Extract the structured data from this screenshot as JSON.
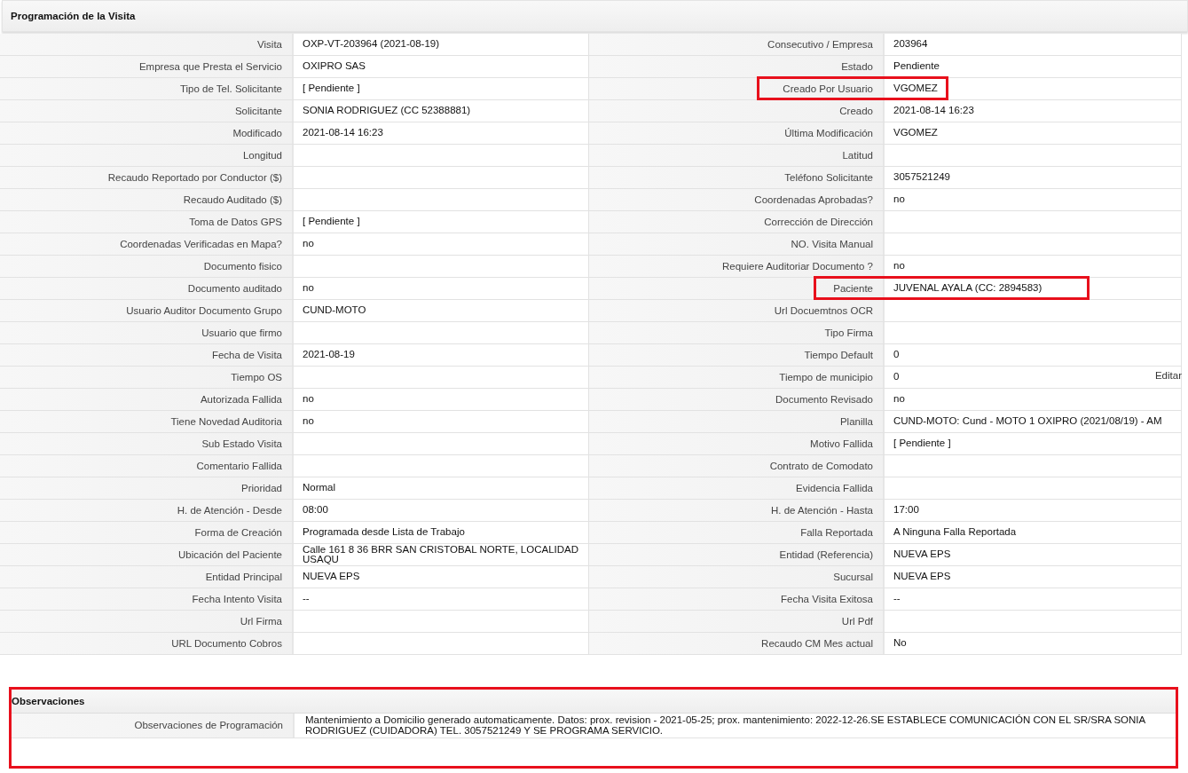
{
  "section_title": "Programación de la Visita",
  "rows": [
    {
      "left": {
        "label": "Visita",
        "value": "OXP-VT-203964 (2021-08-19)"
      },
      "right": {
        "label": "Consecutivo / Empresa",
        "value": "203964",
        "highlighted": false
      }
    },
    {
      "left": {
        "label": "Empresa que Presta el Servicio",
        "value": "OXIPRO SAS"
      },
      "right": {
        "label": "Estado",
        "value": "Pendiente",
        "highlighted": false
      }
    },
    {
      "left": {
        "label": "Tipo de Tel. Solicitante",
        "value": "[ Pendiente ]"
      },
      "right": {
        "label": "Creado Por Usuario",
        "value": "VGOMEZ",
        "highlighted": true
      }
    },
    {
      "left": {
        "label": "Solicitante",
        "value": "SONIA RODRIGUEZ (CC 52388881)"
      },
      "right": {
        "label": "Creado",
        "value": "2021-08-14 16:23",
        "highlighted": false
      }
    },
    {
      "left": {
        "label": "Modificado",
        "value": "2021-08-14 16:23"
      },
      "right": {
        "label": "Última Modificación",
        "value": "VGOMEZ",
        "highlighted": false
      }
    },
    {
      "left": {
        "label": "Longitud"
      },
      "right": {
        "label": "Latitud",
        "highlighted": false
      }
    },
    {
      "left": {
        "label": "Recaudo Reportado por Conductor ($)"
      },
      "right": {
        "label": "Teléfono Solicitante",
        "value": "3057521249",
        "highlighted": false
      }
    },
    {
      "left": {
        "label": "Recaudo Auditado ($)"
      },
      "right": {
        "label": "Coordenadas Aprobadas?",
        "value": "no",
        "highlighted": false
      }
    },
    {
      "left": {
        "label": "Toma de Datos GPS",
        "value": "[ Pendiente ]"
      },
      "right": {
        "label": "Corrección de Dirección",
        "highlighted": false
      }
    },
    {
      "left": {
        "label": "Coordenadas Verificadas en Mapa?",
        "value": "no"
      },
      "right": {
        "label": "NO. Visita Manual",
        "highlighted": false
      }
    },
    {
      "left": {
        "label": "Documento fisico"
      },
      "right": {
        "label": "Requiere Auditoriar Documento ?",
        "value": "no",
        "highlighted": false
      }
    },
    {
      "left": {
        "label": "Documento auditado",
        "value": "no"
      },
      "right": {
        "label": "Paciente",
        "value": "JUVENAL AYALA (CC: 2894583)",
        "highlighted": true
      }
    },
    {
      "left": {
        "label": "Usuario Auditor Documento Grupo",
        "value": "CUND-MOTO"
      },
      "right": {
        "label": "Url Docuemtnos OCR",
        "highlighted": false
      }
    },
    {
      "left": {
        "label": "Usuario que firmo"
      },
      "right": {
        "label": "Tipo Firma",
        "highlighted": false
      }
    },
    {
      "left": {
        "label": "Fecha de Visita",
        "value": "2021-08-19"
      },
      "right": {
        "label": "Tiempo Default",
        "value": "0",
        "highlighted": false
      }
    },
    {
      "left": {
        "label": "Tiempo OS"
      },
      "right": {
        "label": "Tiempo de municipio",
        "value": "0",
        "highlighted": false,
        "link": "Editar"
      }
    },
    {
      "left": {
        "label": "Autorizada Fallida",
        "value": "no"
      },
      "right": {
        "label": "Documento Revisado",
        "value": "no",
        "highlighted": false
      }
    },
    {
      "left": {
        "label": "Tiene Novedad Auditoria",
        "value": "no"
      },
      "right": {
        "label": "Planilla",
        "value": "CUND-MOTO: Cund - MOTO 1 OXIPRO (2021/08/19) - AM",
        "highlighted": false
      }
    },
    {
      "left": {
        "label": "Sub Estado Visita"
      },
      "right": {
        "label": "Motivo Fallida",
        "value": "[ Pendiente ]",
        "highlighted": false
      }
    },
    {
      "left": {
        "label": "Comentario Fallida"
      },
      "right": {
        "label": "Contrato de Comodato",
        "highlighted": false
      }
    },
    {
      "left": {
        "label": "Prioridad",
        "value": "Normal"
      },
      "right": {
        "label": "Evidencia Fallida",
        "highlighted": false
      }
    },
    {
      "left": {
        "label": "H. de Atención - Desde",
        "value": "08:00"
      },
      "right": {
        "label": "H. de Atención - Hasta",
        "value": "17:00",
        "highlighted": false
      }
    },
    {
      "left": {
        "label": "Forma de Creación",
        "value": "Programada desde Lista de Trabajo"
      },
      "right": {
        "label": "Falla Reportada",
        "value": "A Ninguna Falla Reportada",
        "highlighted": false
      }
    },
    {
      "left": {
        "label": "Ubicación del Paciente",
        "value": "Calle 161 8 36 BRR SAN CRISTOBAL NORTE, LOCALIDAD USAQU"
      },
      "right": {
        "label": "Entidad (Referencia)",
        "value": "NUEVA EPS",
        "highlighted": false
      }
    },
    {
      "left": {
        "label": "Entidad Principal",
        "value": "NUEVA EPS"
      },
      "right": {
        "label": "Sucursal",
        "value": "NUEVA EPS",
        "highlighted": false
      }
    },
    {
      "left": {
        "label": "Fecha Intento Visita",
        "value": "--"
      },
      "right": {
        "label": "Fecha Visita Exitosa",
        "value": "--",
        "highlighted": false
      }
    },
    {
      "left": {
        "label": "Url Firma"
      },
      "right": {
        "label": "Url Pdf",
        "highlighted": false
      }
    },
    {
      "left": {
        "label": "URL Documento Cobros"
      },
      "right": {
        "label": "Recaudo CM Mes actual",
        "value": "No",
        "highlighted": false
      }
    }
  ],
  "observations": {
    "title": "Observaciones",
    "highlighted": true,
    "label": "Observaciones de Programación",
    "value": "Mantenimiento a Domicilio generado automaticamente. Datos: prox. revision - 2021-05-25; prox. mantenimiento: 2022-12-26.SE ESTABLECE COMUNICACIÓN CON EL SR/SRA SONIA RODRIGUEZ (CUIDADORA) TEL. 3057521249 Y SE PROGRAMA SERVICIO."
  }
}
